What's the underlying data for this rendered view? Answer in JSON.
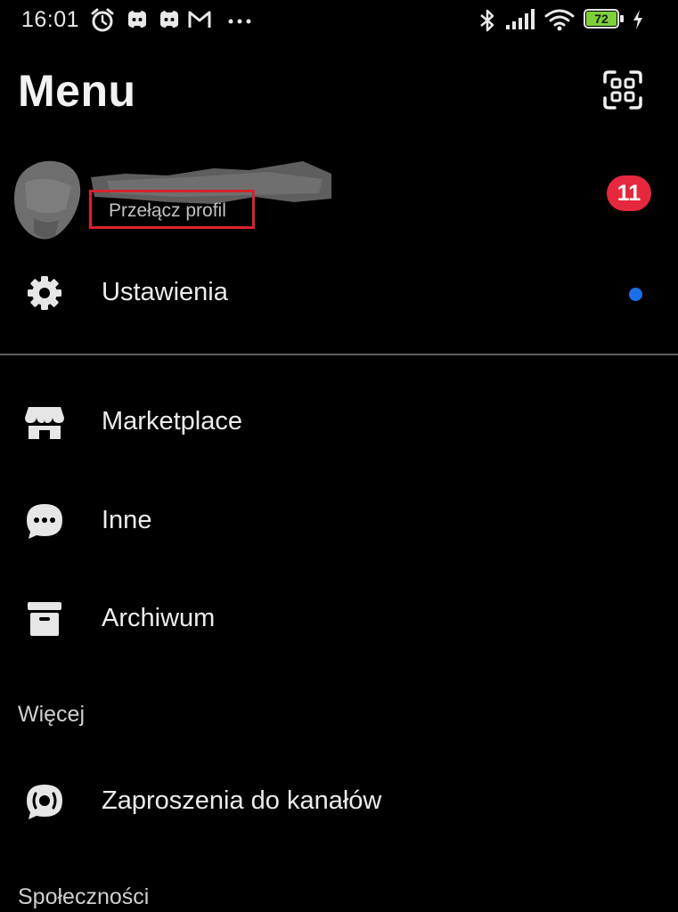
{
  "status_bar": {
    "time": "16:01",
    "battery": "72",
    "notification_icons": [
      "alarm-icon",
      "discord-icon",
      "discord-icon",
      "gmail-icon",
      "more-icon"
    ],
    "system_icons": [
      "bluetooth-icon",
      "signal-icon",
      "wifi-icon",
      "battery-icon",
      "charging-icon"
    ]
  },
  "header": {
    "title": "Menu",
    "qr_icon": "qr-scan-icon"
  },
  "profile": {
    "switch_label": "Przełącz profil",
    "badge_count": "11"
  },
  "menu": {
    "settings": {
      "label": "Ustawienia",
      "icon": "gear-icon",
      "has_dot": true
    },
    "items": [
      {
        "label": "Marketplace",
        "icon": "store-icon"
      },
      {
        "label": "Inne",
        "icon": "chat-bubble-icon"
      },
      {
        "label": "Archiwum",
        "icon": "archive-box-icon"
      }
    ]
  },
  "sections": {
    "more": {
      "header": "Więcej",
      "items": [
        {
          "label": "Zaproszenia do kanałów",
          "icon": "channel-invite-icon"
        }
      ]
    },
    "communities": {
      "header": "Społeczności"
    }
  },
  "colors": {
    "background": "#000000",
    "badge": "#e5283d",
    "dot": "#1a6fe8",
    "highlight_box": "#d8232a",
    "battery": "#7ed03a"
  }
}
